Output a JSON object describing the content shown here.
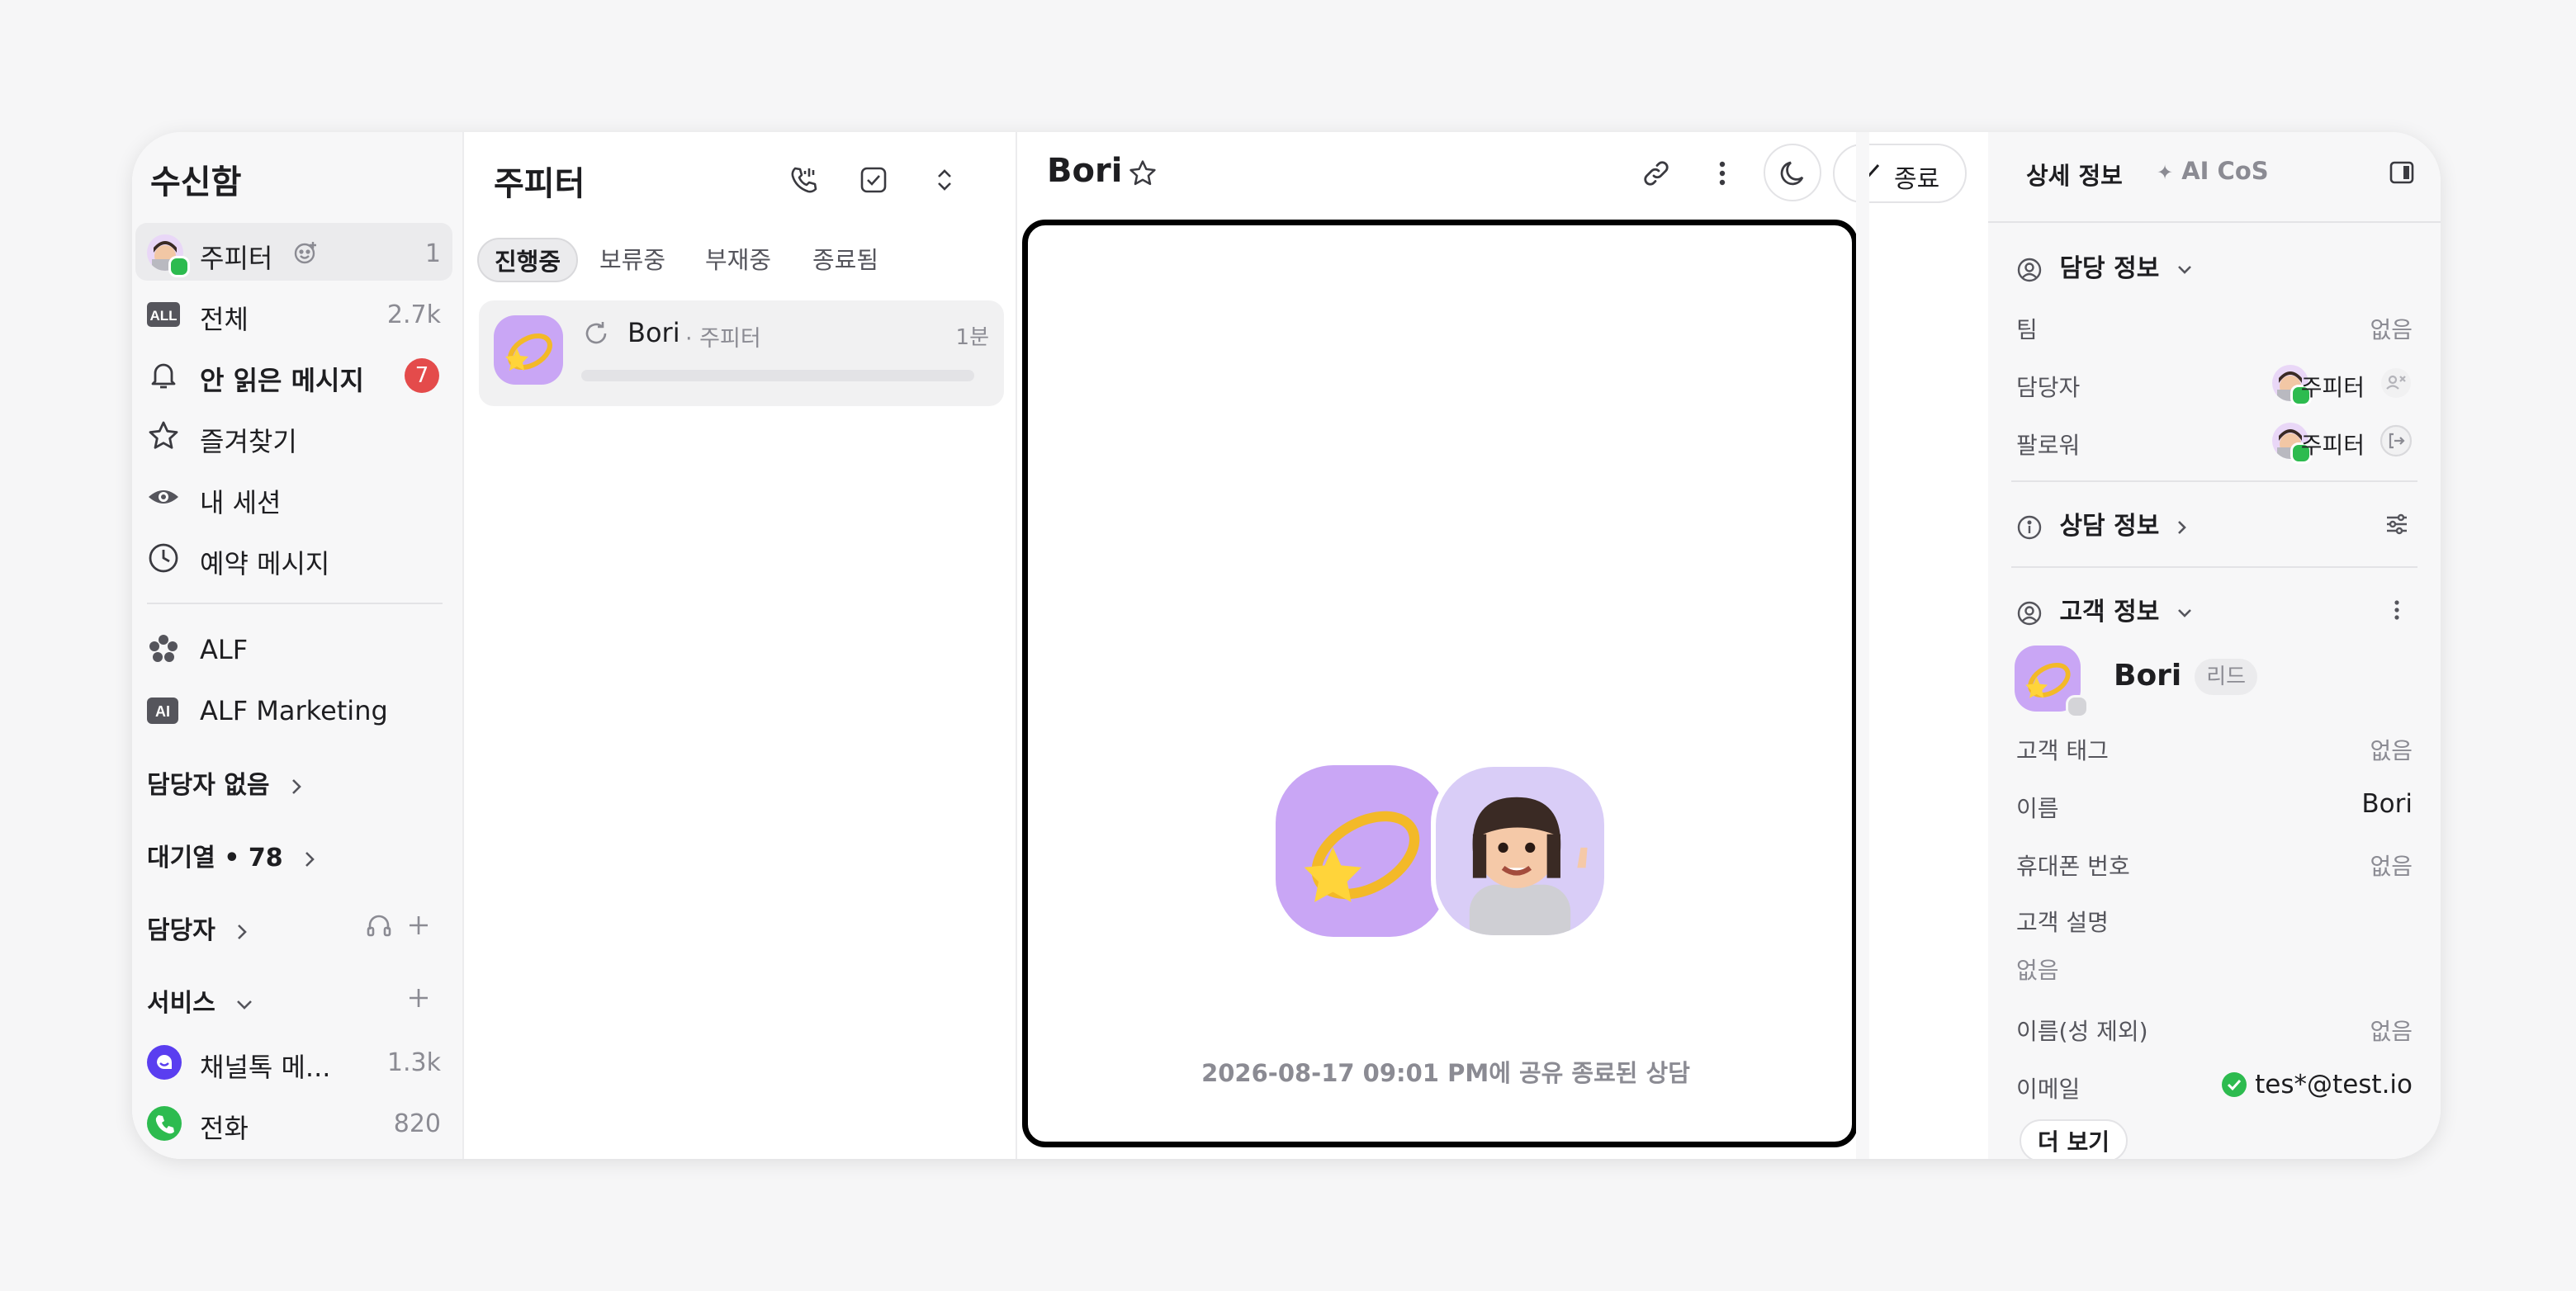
{
  "sidebar": {
    "title": "수신함",
    "items": [
      {
        "label": "주피터",
        "count": "1",
        "icon": "user-avatar-icon"
      },
      {
        "label": "전체",
        "count": "2.7k",
        "icon": "all-icon"
      },
      {
        "label": "안 읽은 메시지",
        "count": "7",
        "icon": "bell-icon"
      },
      {
        "label": "즐겨찾기",
        "count": "",
        "icon": "star-icon"
      },
      {
        "label": "내 세션",
        "count": "",
        "icon": "eye-icon"
      },
      {
        "label": "예약 메시지",
        "count": "",
        "icon": "clock-icon"
      }
    ],
    "bots": [
      {
        "label": "ALF",
        "icon": "alf-icon"
      },
      {
        "label": "ALF Marketing",
        "icon": "ai-icon",
        "icon_text": "AI"
      }
    ],
    "sections": {
      "unassigned": "담당자 없음",
      "queue": "대기열 • 78",
      "assignee": "담당자",
      "services": "서비스"
    },
    "services": [
      {
        "label": "채널톡 메...",
        "count": "1.3k",
        "color": "#5a3ef0"
      },
      {
        "label": "전화",
        "count": "820",
        "color": "#2dbb4f"
      }
    ],
    "all_icon_text": "ALL"
  },
  "list": {
    "title": "주피터",
    "tabs": [
      "진행중",
      "보류중",
      "부재중",
      "종료됨"
    ],
    "active_tab": "진행중",
    "conversation": {
      "name": "Bori",
      "assignee": "· 주피터",
      "time": "1분"
    }
  },
  "chat": {
    "title": "Bori",
    "close_label": "종료",
    "ended_text": "2026-08-17 09:01 PM에 공유 종료된 상담"
  },
  "details": {
    "tab_detail": "상세 정보",
    "tab_ai": "AI CoS",
    "assignment": {
      "title": "담당 정보",
      "team_label": "팀",
      "team_value": "없음",
      "assignee_label": "담당자",
      "assignee_value": "주피터",
      "follower_label": "팔로워",
      "follower_value": "주피터"
    },
    "consult": {
      "title": "상담 정보"
    },
    "customer": {
      "title": "고객 정보",
      "name": "Bori",
      "badge": "리드",
      "tag_label": "고객 태그",
      "tag_value": "없음",
      "name_label": "이름",
      "name_value": "Bori",
      "phone_label": "휴대폰 번호",
      "phone_value": "없음",
      "desc_label": "고객 설명",
      "desc_value": "없음",
      "given_label": "이름(성 제외)",
      "given_value": "없음",
      "email_label": "이메일",
      "email_value": "tes*@test.io"
    },
    "more_label": "더 보기"
  },
  "colors": {
    "accent_purple": "#c9a6f5",
    "online_green": "#2dbb4f",
    "badge_red": "#e44b4b"
  }
}
